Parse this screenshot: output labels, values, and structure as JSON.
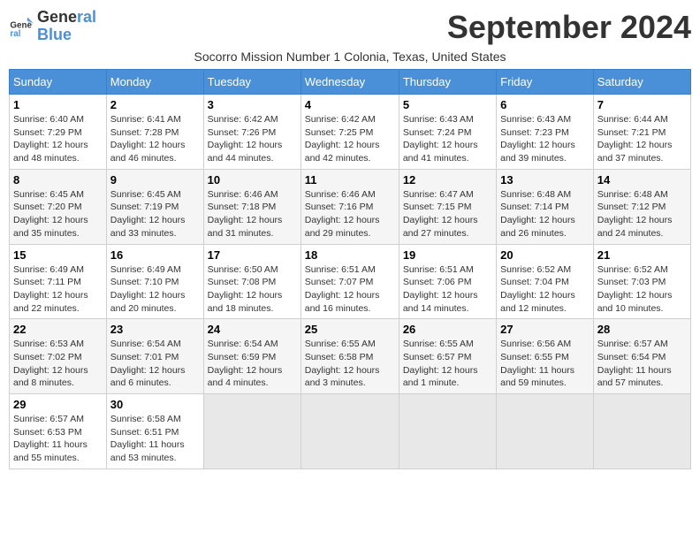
{
  "logo": {
    "line1": "General",
    "line2": "Blue"
  },
  "title": "September 2024",
  "subtitle": "Socorro Mission Number 1 Colonia, Texas, United States",
  "days_of_week": [
    "Sunday",
    "Monday",
    "Tuesday",
    "Wednesday",
    "Thursday",
    "Friday",
    "Saturday"
  ],
  "weeks": [
    [
      {
        "day": "1",
        "rise": "6:40 AM",
        "set": "7:29 PM",
        "daylight": "12 hours and 48 minutes."
      },
      {
        "day": "2",
        "rise": "6:41 AM",
        "set": "7:28 PM",
        "daylight": "12 hours and 46 minutes."
      },
      {
        "day": "3",
        "rise": "6:42 AM",
        "set": "7:26 PM",
        "daylight": "12 hours and 44 minutes."
      },
      {
        "day": "4",
        "rise": "6:42 AM",
        "set": "7:25 PM",
        "daylight": "12 hours and 42 minutes."
      },
      {
        "day": "5",
        "rise": "6:43 AM",
        "set": "7:24 PM",
        "daylight": "12 hours and 41 minutes."
      },
      {
        "day": "6",
        "rise": "6:43 AM",
        "set": "7:23 PM",
        "daylight": "12 hours and 39 minutes."
      },
      {
        "day": "7",
        "rise": "6:44 AM",
        "set": "7:21 PM",
        "daylight": "12 hours and 37 minutes."
      }
    ],
    [
      {
        "day": "8",
        "rise": "6:45 AM",
        "set": "7:20 PM",
        "daylight": "12 hours and 35 minutes."
      },
      {
        "day": "9",
        "rise": "6:45 AM",
        "set": "7:19 PM",
        "daylight": "12 hours and 33 minutes."
      },
      {
        "day": "10",
        "rise": "6:46 AM",
        "set": "7:18 PM",
        "daylight": "12 hours and 31 minutes."
      },
      {
        "day": "11",
        "rise": "6:46 AM",
        "set": "7:16 PM",
        "daylight": "12 hours and 29 minutes."
      },
      {
        "day": "12",
        "rise": "6:47 AM",
        "set": "7:15 PM",
        "daylight": "12 hours and 27 minutes."
      },
      {
        "day": "13",
        "rise": "6:48 AM",
        "set": "7:14 PM",
        "daylight": "12 hours and 26 minutes."
      },
      {
        "day": "14",
        "rise": "6:48 AM",
        "set": "7:12 PM",
        "daylight": "12 hours and 24 minutes."
      }
    ],
    [
      {
        "day": "15",
        "rise": "6:49 AM",
        "set": "7:11 PM",
        "daylight": "12 hours and 22 minutes."
      },
      {
        "day": "16",
        "rise": "6:49 AM",
        "set": "7:10 PM",
        "daylight": "12 hours and 20 minutes."
      },
      {
        "day": "17",
        "rise": "6:50 AM",
        "set": "7:08 PM",
        "daylight": "12 hours and 18 minutes."
      },
      {
        "day": "18",
        "rise": "6:51 AM",
        "set": "7:07 PM",
        "daylight": "12 hours and 16 minutes."
      },
      {
        "day": "19",
        "rise": "6:51 AM",
        "set": "7:06 PM",
        "daylight": "12 hours and 14 minutes."
      },
      {
        "day": "20",
        "rise": "6:52 AM",
        "set": "7:04 PM",
        "daylight": "12 hours and 12 minutes."
      },
      {
        "day": "21",
        "rise": "6:52 AM",
        "set": "7:03 PM",
        "daylight": "12 hours and 10 minutes."
      }
    ],
    [
      {
        "day": "22",
        "rise": "6:53 AM",
        "set": "7:02 PM",
        "daylight": "12 hours and 8 minutes."
      },
      {
        "day": "23",
        "rise": "6:54 AM",
        "set": "7:01 PM",
        "daylight": "12 hours and 6 minutes."
      },
      {
        "day": "24",
        "rise": "6:54 AM",
        "set": "6:59 PM",
        "daylight": "12 hours and 4 minutes."
      },
      {
        "day": "25",
        "rise": "6:55 AM",
        "set": "6:58 PM",
        "daylight": "12 hours and 3 minutes."
      },
      {
        "day": "26",
        "rise": "6:55 AM",
        "set": "6:57 PM",
        "daylight": "12 hours and 1 minute."
      },
      {
        "day": "27",
        "rise": "6:56 AM",
        "set": "6:55 PM",
        "daylight": "11 hours and 59 minutes."
      },
      {
        "day": "28",
        "rise": "6:57 AM",
        "set": "6:54 PM",
        "daylight": "11 hours and 57 minutes."
      }
    ],
    [
      {
        "day": "29",
        "rise": "6:57 AM",
        "set": "6:53 PM",
        "daylight": "11 hours and 55 minutes."
      },
      {
        "day": "30",
        "rise": "6:58 AM",
        "set": "6:51 PM",
        "daylight": "11 hours and 53 minutes."
      },
      null,
      null,
      null,
      null,
      null
    ]
  ]
}
